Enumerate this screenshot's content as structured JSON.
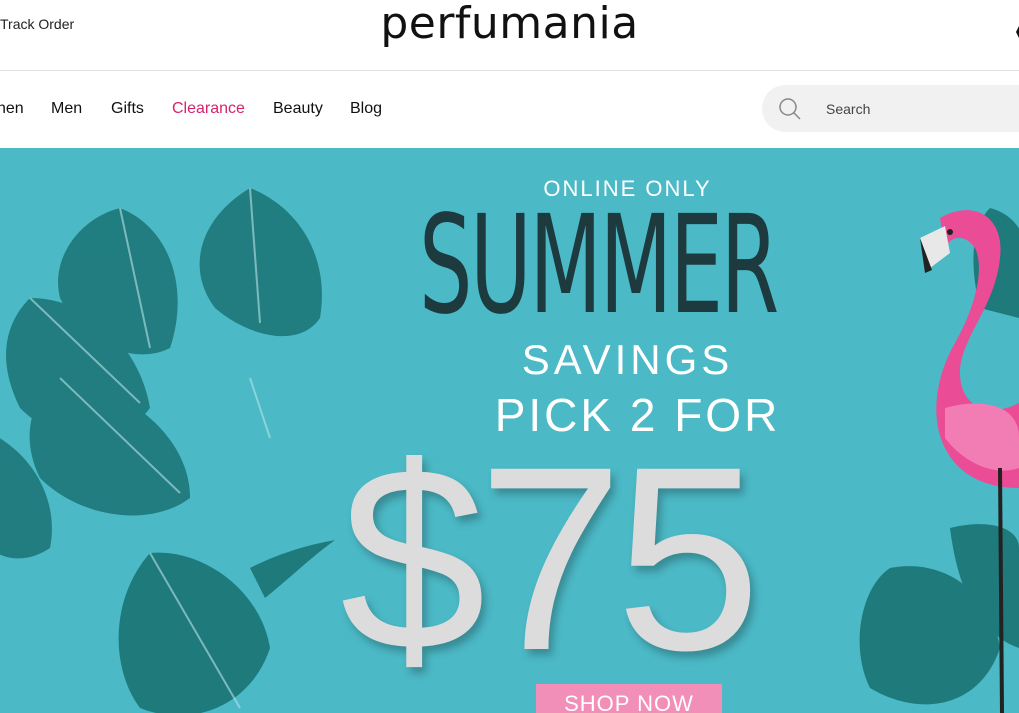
{
  "header": {
    "track_order": "Track Order",
    "logo_text": "perfumania"
  },
  "nav": {
    "items": [
      {
        "label": "nen"
      },
      {
        "label": "Men"
      },
      {
        "label": "Gifts"
      },
      {
        "label": "Clearance",
        "color": "#d6246e"
      },
      {
        "label": "Beauty"
      },
      {
        "label": "Blog"
      }
    ]
  },
  "search": {
    "placeholder": "Search"
  },
  "hero": {
    "online_only": "ONLINE ONLY",
    "title": "SUMMER",
    "subtitle": "SAVINGS",
    "offer": "PICK 2 FOR",
    "price": "$75",
    "cta": "SHOP NOW",
    "background_color": "#4bb9c6",
    "cta_color": "#f18fb8"
  }
}
